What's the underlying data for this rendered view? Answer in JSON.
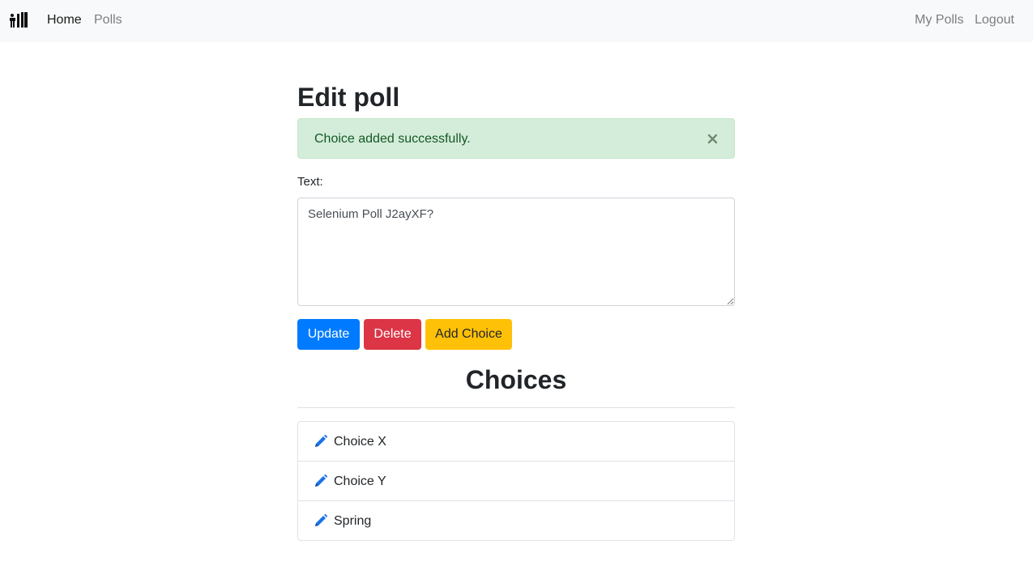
{
  "nav": {
    "left_links": [
      {
        "label": "Home",
        "active": true
      },
      {
        "label": "Polls",
        "active": false
      }
    ],
    "right_links": [
      {
        "label": "My Polls"
      },
      {
        "label": "Logout"
      }
    ],
    "brand_icon": "poll-bars-icon"
  },
  "page": {
    "title": "Edit poll"
  },
  "alert": {
    "message": "Choice added successfully.",
    "close_icon": "close-icon",
    "color": "#d4edda"
  },
  "form": {
    "text_label": "Text:",
    "text_value": "Selenium Poll J2ayXF?",
    "buttons": {
      "update": "Update",
      "delete": "Delete",
      "add_choice": "Add Choice"
    }
  },
  "choices": {
    "heading": "Choices",
    "edit_icon": "pencil-icon",
    "items": [
      {
        "label": "Choice X"
      },
      {
        "label": "Choice Y"
      },
      {
        "label": "Spring"
      }
    ]
  },
  "colors": {
    "primary": "#007bff",
    "danger": "#dc3545",
    "warning": "#ffc107",
    "success_bg": "#d4edda",
    "success_text": "#155724"
  }
}
